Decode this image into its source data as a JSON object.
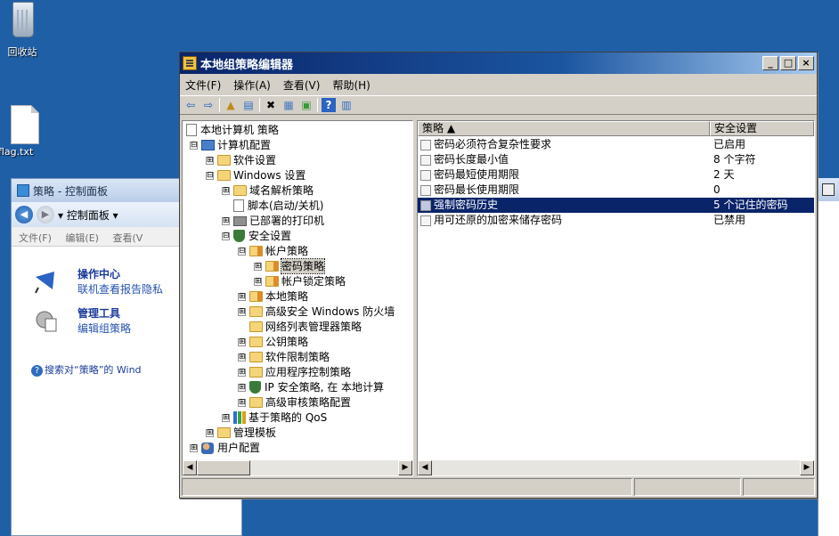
{
  "desktop": {
    "recycle_bin_label": "回收站",
    "file_label": "flag.txt"
  },
  "control_panel": {
    "title": "策略 - 控制面板",
    "breadcrumb": "▾ 控制面板 ▾",
    "menu": [
      "文件(F)",
      "编辑(E)",
      "查看(V"
    ],
    "results": [
      {
        "title": "操作中心",
        "sub": "联机查看报告隐私"
      },
      {
        "title": "管理工具",
        "sub": "编辑组策略"
      }
    ],
    "search_text": "搜索对“策略”的 Wind"
  },
  "gpedit": {
    "title": "本地组策略编辑器",
    "window_buttons": [
      "_",
      "□",
      "×"
    ],
    "menu": [
      "文件(F)",
      "操作(A)",
      "查看(V)",
      "帮助(H)"
    ],
    "tree": [
      {
        "label": "本地计算机 策略"
      },
      {
        "label": "计算机配置",
        "exp": "⊟"
      },
      {
        "label": "软件设置",
        "exp": "⊞"
      },
      {
        "label": "Windows 设置",
        "exp": "⊟"
      },
      {
        "label": "域名解析策略",
        "exp": "⊞"
      },
      {
        "label": "脚本(启动/关机)"
      },
      {
        "label": "已部署的打印机",
        "exp": "⊞"
      },
      {
        "label": "安全设置",
        "exp": "⊟"
      },
      {
        "label": "帐户策略",
        "exp": "⊟"
      },
      {
        "label": "密码策略",
        "exp": "⊞"
      },
      {
        "label": "帐户锁定策略",
        "exp": "⊞"
      },
      {
        "label": "本地策略",
        "exp": "⊞"
      },
      {
        "label": "高级安全 Windows 防火墙",
        "exp": "⊞"
      },
      {
        "label": "网络列表管理器策略"
      },
      {
        "label": "公钥策略",
        "exp": "⊞"
      },
      {
        "label": "软件限制策略",
        "exp": "⊞"
      },
      {
        "label": "应用程序控制策略",
        "exp": "⊞"
      },
      {
        "label": "IP 安全策略, 在 本地计算",
        "exp": "⊞"
      },
      {
        "label": "高级审核策略配置",
        "exp": "⊞"
      },
      {
        "label": "基于策略的 QoS",
        "exp": "⊞"
      },
      {
        "label": "管理模板",
        "exp": "⊞"
      },
      {
        "label": "用户配置",
        "exp": "⊞"
      }
    ],
    "columns": {
      "policy": "策略 ▲",
      "setting": "安全设置"
    },
    "rows": [
      {
        "policy": "密码必须符合复杂性要求",
        "setting": "已启用"
      },
      {
        "policy": "密码长度最小值",
        "setting": "8 个字符"
      },
      {
        "policy": "密码最短使用期限",
        "setting": "2 天"
      },
      {
        "policy": "密码最长使用期限",
        "setting": "0"
      },
      {
        "policy": "强制密码历史",
        "setting": "5 个记住的密码"
      },
      {
        "policy": "用可还原的加密来储存密码",
        "setting": "已禁用"
      }
    ]
  }
}
